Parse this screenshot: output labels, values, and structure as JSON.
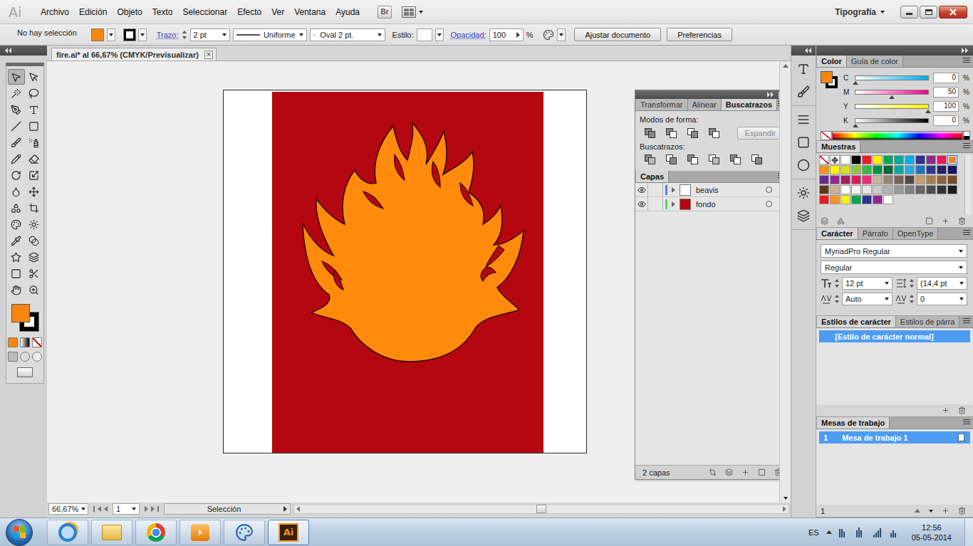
{
  "app": {
    "logo": "Ai",
    "menu": [
      "Archivo",
      "Edición",
      "Objeto",
      "Texto",
      "Seleccionar",
      "Efecto",
      "Ver",
      "Ventana",
      "Ayuda"
    ],
    "bridge": "Br",
    "workspace": "Tipografía"
  },
  "control_bar": {
    "selection": "No hay selección",
    "fill": "#f7860f",
    "stroke": "#000000",
    "stroke_label": "Trazo:",
    "stroke_weight": "2 pt",
    "profile": "Uniforme",
    "brush_dot": "·",
    "brush": "Oval 2 pt.",
    "style_label": "Estilo:",
    "opacity_label": "Opacidad:",
    "opacity": "100",
    "opacity_unit": "%",
    "buttons": [
      "Ajustar documento",
      "Preferencias"
    ]
  },
  "document": {
    "tab": "fire.ai* al 66,67% (CMYK/Previsualizar)",
    "close": "×"
  },
  "toolbox": {
    "fill": "#f7860f",
    "stroke": "#000000",
    "tools": [
      {
        "selected": true
      },
      {
        "selected": false
      },
      {
        "selected": false
      },
      {
        "selected": false
      },
      {
        "selected": false
      },
      {
        "selected": false
      },
      {
        "selected": false
      },
      {
        "selected": false
      },
      {
        "selected": false
      },
      {
        "selected": false
      },
      {
        "selected": false
      },
      {
        "selected": false
      },
      {
        "selected": false
      },
      {
        "selected": false
      },
      {
        "selected": false
      },
      {
        "selected": false
      },
      {
        "selected": false
      },
      {
        "selected": false
      },
      {
        "selected": false
      },
      {
        "selected": false
      },
      {
        "selected": false
      },
      {
        "selected": false
      },
      {
        "selected": false
      },
      {
        "selected": false
      },
      {
        "selected": false
      },
      {
        "selected": false
      },
      {
        "selected": false
      },
      {
        "selected": false
      }
    ]
  },
  "float_panel": {
    "tabs": [
      {
        "label": "Transformar",
        "selected": false
      },
      {
        "label": "Alinear",
        "selected": false
      },
      {
        "label": "Buscatrazos",
        "selected": true
      }
    ],
    "shape_modes_label": "Modos de forma:",
    "expand": {
      "label": "Expandir",
      "disabled": true
    },
    "pathfinders_label": "Buscatrazos:"
  },
  "layers": {
    "tab": "Capas",
    "items": [
      {
        "name": "beavis",
        "visible": true,
        "color": "#4f7df5",
        "thumb": "#ffffff"
      },
      {
        "name": "fondo",
        "visible": true,
        "color": "#4fd663",
        "thumb": "#b5070f"
      }
    ],
    "count": "2 capas"
  },
  "color": {
    "tabs": [
      {
        "label": "Color",
        "selected": true
      },
      {
        "label": "Guía de color",
        "selected": false
      }
    ],
    "fill": "#f7860f",
    "stroke": "#000000",
    "channels": [
      {
        "name": "C",
        "value": "0",
        "unit": "%",
        "level": 0,
        "color": "#00aeef"
      },
      {
        "name": "M",
        "value": "50",
        "unit": "%",
        "level": 0.5,
        "color": "#ec008c"
      },
      {
        "name": "Y",
        "value": "100",
        "unit": "%",
        "level": 1,
        "color": "#fff200"
      },
      {
        "name": "K",
        "value": "0",
        "unit": "%",
        "level": 0,
        "color": "#000000"
      }
    ]
  },
  "swatches": {
    "tab": "Muestras",
    "special": [
      {
        "kind": "none",
        "selected": false
      },
      {
        "kind": "registration",
        "selected": false
      }
    ],
    "rows": [
      [
        {
          "color": "#ffffff",
          "selected": false
        },
        {
          "color": "#000000",
          "selected": false
        },
        {
          "color": "#ed1c24",
          "selected": false
        },
        {
          "color": "#fff200",
          "selected": false
        },
        {
          "color": "#00a651",
          "selected": false
        },
        {
          "color": "#00a99d",
          "selected": false
        },
        {
          "color": "#00aeef",
          "selected": false
        },
        {
          "color": "#2e3192",
          "selected": false
        },
        {
          "color": "#92278f",
          "selected": false
        },
        {
          "color": "#ed145b",
          "selected": false
        },
        {
          "color": "#f7860f",
          "selected": true
        }
      ],
      [
        {
          "color": "#f7941d",
          "selected": false
        },
        {
          "color": "#fff200",
          "selected": false
        },
        {
          "color": "#d7df23",
          "selected": false
        },
        {
          "color": "#8dc63f",
          "selected": false
        },
        {
          "color": "#39b54a",
          "selected": false
        },
        {
          "color": "#009444",
          "selected": false
        },
        {
          "color": "#006838",
          "selected": false
        },
        {
          "color": "#00a79d",
          "selected": false
        },
        {
          "color": "#27aae1",
          "selected": false
        },
        {
          "color": "#1c75bc",
          "selected": false
        },
        {
          "color": "#2b3990",
          "selected": false
        },
        {
          "color": "#262262",
          "selected": false
        },
        {
          "color": "#1b1464",
          "selected": false
        }
      ],
      [
        {
          "color": "#662d91",
          "selected": false
        },
        {
          "color": "#92278f",
          "selected": false
        },
        {
          "color": "#9e1f63",
          "selected": false
        },
        {
          "color": "#da1c5c",
          "selected": false
        },
        {
          "color": "#ee2a7b",
          "selected": false
        },
        {
          "color": "#c2b59b",
          "selected": false
        },
        {
          "color": "#998675",
          "selected": false
        },
        {
          "color": "#736357",
          "selected": false
        },
        {
          "color": "#534741",
          "selected": false
        },
        {
          "color": "#c69c6d",
          "selected": false
        },
        {
          "color": "#a67c52",
          "selected": false
        },
        {
          "color": "#8c6239",
          "selected": false
        },
        {
          "color": "#754c24",
          "selected": false
        }
      ],
      [
        {
          "color": "#603813",
          "selected": false
        },
        {
          "color": "#c7b299",
          "selected": false
        },
        {
          "color": "#ffffff",
          "selected": false
        },
        {
          "color": "#f2f2f2",
          "selected": false
        },
        {
          "color": "#e6e6e6",
          "selected": false
        },
        {
          "color": "#cccccc",
          "selected": false
        },
        {
          "color": "#b3b3b3",
          "selected": false
        },
        {
          "color": "#999999",
          "selected": false
        },
        {
          "color": "#808080",
          "selected": false
        },
        {
          "color": "#666666",
          "selected": false
        },
        {
          "color": "#4d4d4d",
          "selected": false
        },
        {
          "color": "#333333",
          "selected": false
        },
        {
          "color": "#1a1a1a",
          "selected": false
        }
      ],
      [
        {
          "color": "#ed1c24",
          "selected": false
        },
        {
          "color": "#f7941d",
          "selected": false
        },
        {
          "color": "#fff200",
          "selected": false
        },
        {
          "color": "#00a651",
          "selected": false
        },
        {
          "color": "#2e3192",
          "selected": false
        },
        {
          "color": "#92278f",
          "selected": false
        },
        {
          "color": "#ffffff",
          "selected": false
        }
      ]
    ]
  },
  "character": {
    "tabs": [
      {
        "label": "Carácter",
        "selected": true
      },
      {
        "label": "Párrafo",
        "selected": false
      },
      {
        "label": "OpenType",
        "selected": false
      }
    ],
    "font": "MyriadPro Regular",
    "style": "Regular",
    "size": "12 pt",
    "leading": "(14,4 pt",
    "kerning": "Auto",
    "tracking": "0"
  },
  "char_styles": {
    "tabs": [
      {
        "label": "Estilos de carácter",
        "selected": true
      },
      {
        "label": "Estilos de párra",
        "selected": false
      }
    ],
    "items": [
      {
        "label": "[Estilo de carácter normal]",
        "selected": true
      }
    ]
  },
  "artboards": {
    "tab": "Mesas de trabajo",
    "items": [
      {
        "number": "1",
        "name": "Mesa de trabajo 1",
        "selected": true
      }
    ],
    "count": "1"
  },
  "status_bar": {
    "zoom": "66,67%",
    "page": "1",
    "tool": "Selección"
  },
  "taskbar": {
    "apps": [
      {
        "kind": "ie",
        "active": false
      },
      {
        "kind": "folder",
        "active": false
      },
      {
        "kind": "chrome",
        "active": false
      },
      {
        "kind": "media",
        "active": false
      },
      {
        "kind": "paint",
        "active": false
      },
      {
        "kind": "illustrator",
        "active": true,
        "label": "Ai"
      }
    ],
    "language": "ES",
    "time": "12:56",
    "date": "05-05-2014"
  }
}
